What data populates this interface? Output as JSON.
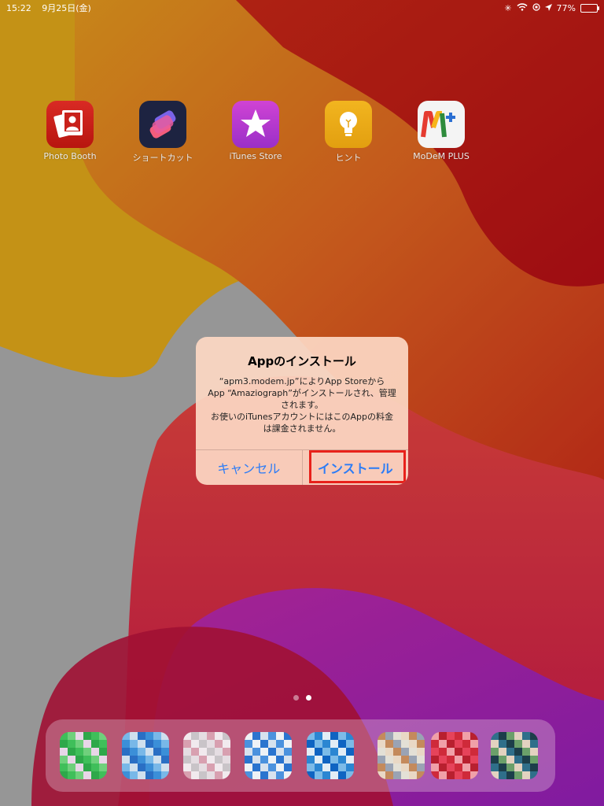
{
  "statusbar": {
    "time": "15:22",
    "date": "9月25日(金)",
    "battery_percent": "77%",
    "battery_level": 0.77
  },
  "home_apps": [
    {
      "label": "Photo Booth",
      "icon": "photo-booth-icon"
    },
    {
      "label": "ショートカット",
      "icon": "shortcuts-icon"
    },
    {
      "label": "iTunes Store",
      "icon": "itunes-store-icon"
    },
    {
      "label": "ヒント",
      "icon": "tips-icon"
    },
    {
      "label": "MoDeM PLUS",
      "icon": "modem-plus-icon"
    }
  ],
  "dialog": {
    "title": "Appのインストール",
    "message": "“apm3.modem.jp”によりApp Storeから\nApp “Amaziograph”がインストールされ、管理されます。\nお使いのiTunesアカウントにはこのAppの料金は課金されません。",
    "cancel_label": "キャンセル",
    "install_label": "インストール"
  },
  "page_indicator": {
    "pages": 2,
    "current": 2
  },
  "colors": {
    "accent": "#2c7cf6",
    "highlight_box": "#e8211a"
  }
}
